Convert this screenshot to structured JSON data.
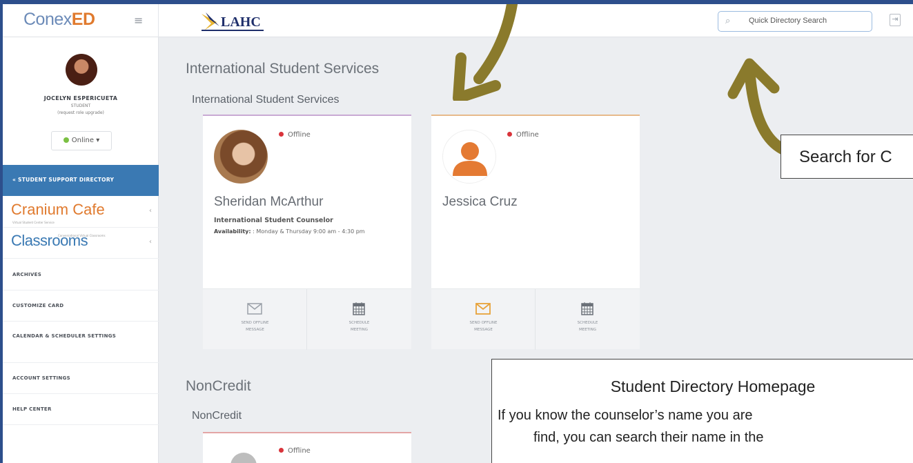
{
  "header": {
    "brand_part1": "Conex",
    "brand_part2": "ED",
    "search_placeholder": "Quick Directory Search",
    "icons": [
      "menu-icon",
      "search-icon",
      "exit-icon"
    ]
  },
  "user": {
    "name": "JOCELYN ESPERICUETA",
    "role": "STUDENT",
    "upgrade": "(request role upgrade)",
    "status": "Online ▾"
  },
  "sidebar": {
    "active_item": "« STUDENT SUPPORT DIRECTORY",
    "modules": [
      {
        "label": "Cranium Cafe",
        "sub": "Virtual Student Center Service"
      },
      {
        "label": "Classrooms",
        "sub": "Conversational Virtual Classrooms"
      }
    ],
    "items": [
      "ARCHIVES",
      "CUSTOMIZE CARD",
      "CALENDAR & SCHEDULER SETTINGS",
      "ACCOUNT SETTINGS",
      "HELP CENTER"
    ]
  },
  "main": {
    "sections": [
      {
        "title": "International Student Services",
        "group": "International Student Services",
        "cards": [
          {
            "status": "Offline",
            "name": "Sheridan McArthur",
            "title": "International Student Counselor",
            "availability_label": "Availability:",
            "availability": " : Monday & Thursday 9:00 am - 4:30 pm",
            "action_left_1": "SEND OFFLINE",
            "action_left_2": "MESSAGE",
            "action_right_1": "SCHEDULE",
            "action_right_2": "MEETING"
          },
          {
            "status": "Offline",
            "name": "Jessica Cruz",
            "action_left_1": "SEND OFFLINE",
            "action_left_2": "MESSAGE",
            "action_right_1": "SCHEDULE",
            "action_right_2": "MEETING"
          }
        ]
      },
      {
        "title": "NonCredit",
        "group": "NonCredit",
        "cards": [
          {
            "status": "Offline"
          }
        ]
      }
    ]
  },
  "annotations": {
    "search_callout": "Search for C",
    "home_title": "Student Directory Homepage",
    "home_line1": "If you know the counselor’s name you are",
    "home_line2": "find, you can search their name in the"
  },
  "colors": {
    "frame": "#2d4f8c",
    "accent": "#3a79b3",
    "brand_orange": "#e07a2e",
    "offline": "#d9343b",
    "online": "#7bc043",
    "arrow": "#8a7a2c"
  }
}
